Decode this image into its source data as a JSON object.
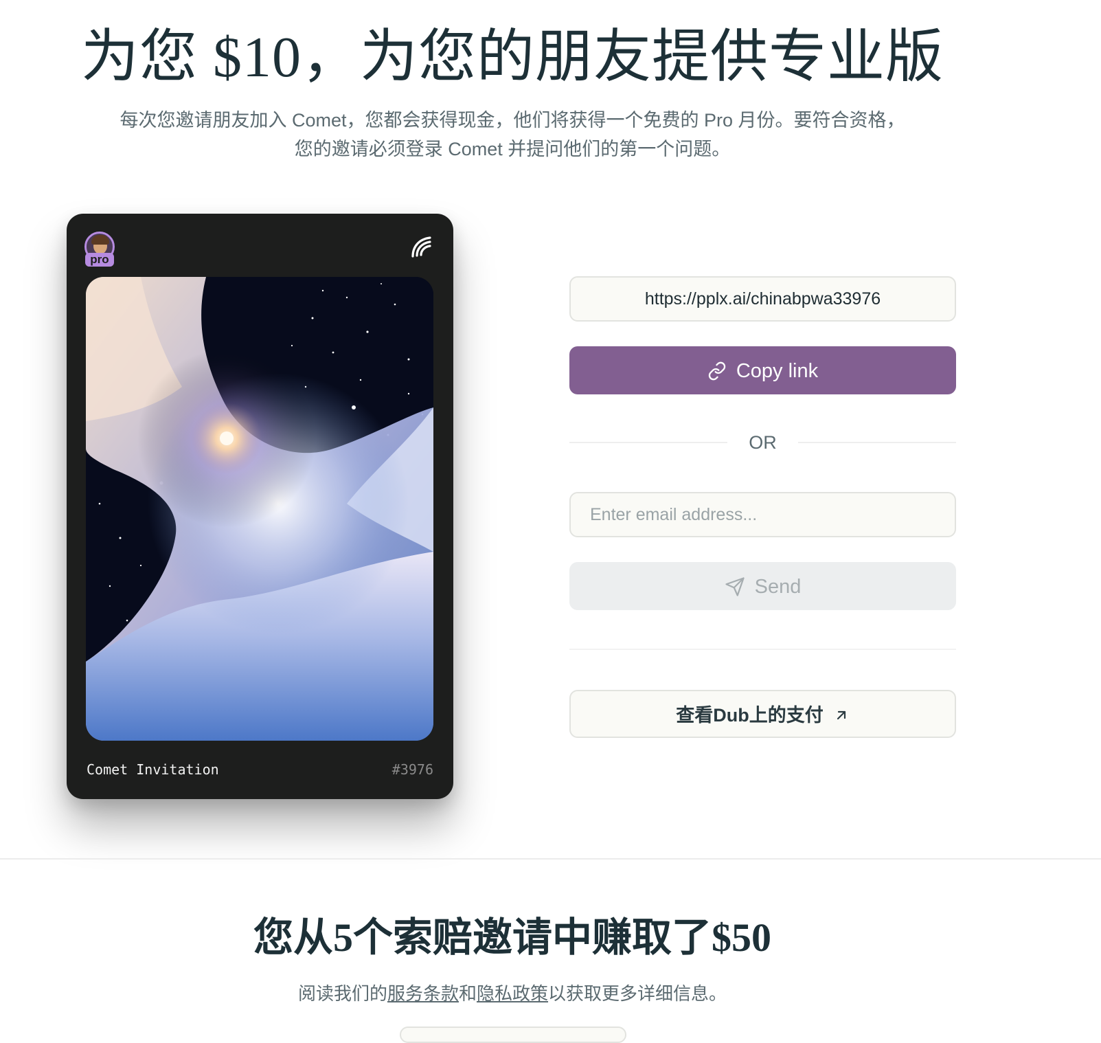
{
  "hero": {
    "title": "为您 $10，为您的朋友提供专业版",
    "subtitle": "每次您邀请朋友加入 Comet，您都会获得现金，他们将获得一个免费的 Pro 月份。要符合资格，您的邀请必须登录 Comet 并提问他们的第一个问题。"
  },
  "card": {
    "badge": "pro",
    "title": "Comet Invitation",
    "number": "#3976",
    "avatar_icon": "avatar-icon",
    "logo_icon": "comet-logo-icon",
    "image": "cosmic-clouds-image"
  },
  "share": {
    "link_value": "https://pplx.ai/chinabpwa33976",
    "copy_label": "Copy link",
    "copy_icon": "link-icon",
    "or_label": "OR",
    "email_placeholder": "Enter email address...",
    "send_label": "Send",
    "send_icon": "send-icon",
    "payouts_label": "查看Dub上的支付",
    "payouts_icon": "arrow-up-right-icon"
  },
  "earnings": {
    "title": "您从5个索赔邀请中赚取了$50",
    "terms_prefix": "阅读我们的",
    "terms_link": "服务条款",
    "terms_and": "和",
    "privacy_link": "隐私政策",
    "terms_suffix": "以获取更多详细信息。"
  },
  "colors": {
    "accent": "#825f91",
    "card_bg": "#1d1e1d",
    "pro_badge": "#b68be0",
    "heading": "#1d3037",
    "muted": "#5b6a70"
  }
}
